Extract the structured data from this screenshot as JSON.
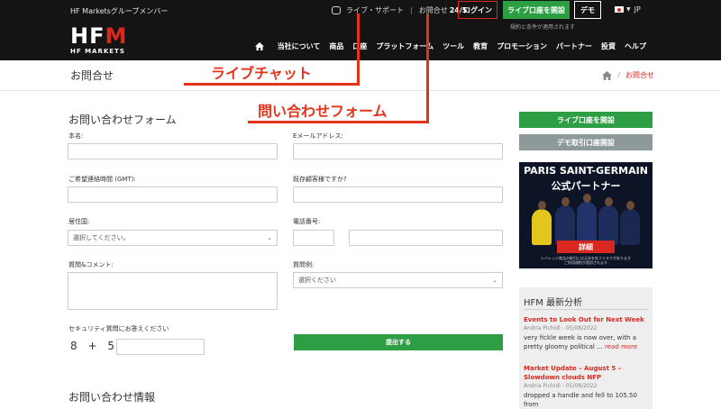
{
  "header": {
    "group_text": "HF Marketsグループメンバー",
    "live_support": "ライブ・サポート",
    "separator": "|",
    "contact_label": "お問合せ",
    "contact_hours": "24/5",
    "login_label": "ログイン",
    "open_live_label": "ライブ口座を開設",
    "demo_label": "デモ",
    "risk_note": "規約と条件が適用されます",
    "language": "JP",
    "logo_text_1": "HF",
    "logo_text_2": "M",
    "logo_sub": "HF MARKETS"
  },
  "nav": {
    "items": [
      "当社について",
      "商品",
      "口座",
      "プラットフォーム",
      "ツール",
      "教育",
      "プロモーション",
      "パートナー",
      "投資",
      "ヘルプ"
    ]
  },
  "page": {
    "title": "お問合せ",
    "breadcrumb_current": "お問合せ"
  },
  "annotations": {
    "chat": "ライブチャット",
    "form": "問い合わせフォーム"
  },
  "form": {
    "title": "お問い合わせフォーム",
    "name_label": "本名:",
    "email_label": "Eメールアドレス:",
    "time_label": "ご希望連絡時間 (GMT):",
    "existing_label": "既存顧客様ですか?",
    "residence_label": "居住国:",
    "residence_value": "選択してください。",
    "phone_label": "電話番号:",
    "comment_label": "質問&コメント:",
    "example_label": "質問例:",
    "example_value": "選択ください",
    "security_label": "セキュリティ質問にお答えください",
    "captcha": "8 + 5",
    "submit_label": "提出する",
    "info_title": "お問い合わせ情報"
  },
  "sidebar": {
    "live_label": "ライブ口座を開設",
    "demo_label": "デモ取引口座開設",
    "banner_title_1": "PARIS SAINT-GERMAIN",
    "banner_title_2": "公式パートナー",
    "banner_button": "詳細",
    "banner_fine_1": "レバレッジ商品の取引には元本を失うリスクがあります",
    "banner_fine_2": "ご利用規約が適用されます",
    "news_title": "HFM 最新分析",
    "news": [
      {
        "title": "Events to Look Out for Next Week",
        "meta": "Andria Pichidi - 05/08/2022",
        "body": "very fickle week is now over, with a pretty gloomy political ...",
        "more": "read more"
      },
      {
        "title": "Market Update – August 5 – Slowdown clouds NFP",
        "meta": "Andria Pichidi - 05/08/2022",
        "body": "dropped a handle and fell to 105.50 from",
        "more": ""
      }
    ]
  },
  "colors": {
    "header_bg": "#141414",
    "accent_red": "#d9281f",
    "green": "#2e9e45",
    "annotation_red": "#e5331b"
  }
}
